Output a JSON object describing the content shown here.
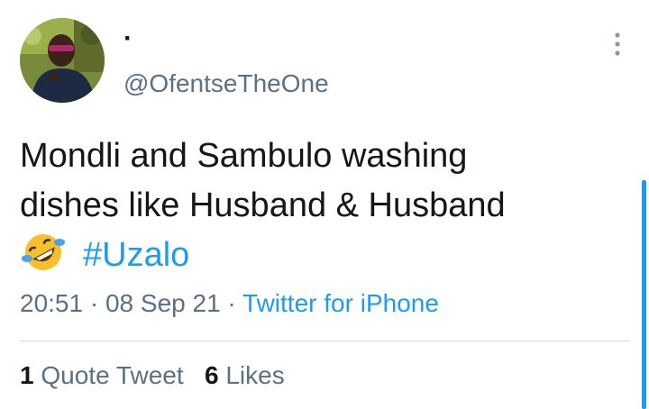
{
  "user": {
    "display_name": "·",
    "handle": "@OfentseTheOne",
    "avatar_icon": "profile-photo"
  },
  "tweet": {
    "text_line_1": "Mondli and Sambulo washing",
    "text_line_2": "dishes like Husband & Husband",
    "emoji_icon": "rolling-on-floor-laughing-emoji",
    "hashtag": "#Uzalo",
    "time": "20:51",
    "sep_1": " · ",
    "date": "08 Sep 21",
    "sep_2": " · ",
    "source": "Twitter for iPhone"
  },
  "stats": {
    "quote_count": "1",
    "quote_label": "Quote Tweet",
    "like_count": "6",
    "like_label": "Likes"
  },
  "colors": {
    "accent": "#1d9bf0",
    "secondary_text": "#5b7083",
    "primary_text": "#14171a"
  }
}
